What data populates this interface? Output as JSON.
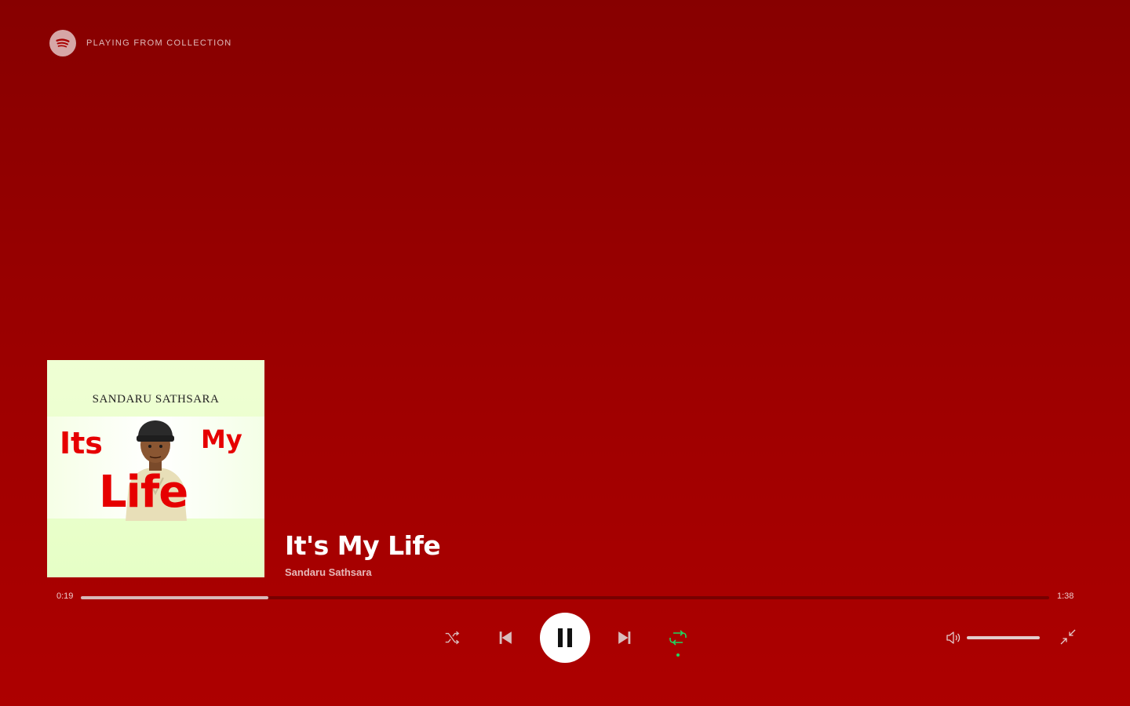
{
  "header": {
    "context_label": "PLAYING FROM COLLECTION",
    "logo_icon": "spotify-logo-icon"
  },
  "cover_art": {
    "artist_text": "SANDARU SATHSARA",
    "word_1": "Its",
    "word_2": "My",
    "word_3": "Life"
  },
  "track": {
    "title": "It's My Life",
    "artist": "Sandaru Sathsara"
  },
  "playback": {
    "elapsed": "0:19",
    "duration": "1:38",
    "progress_fraction": 0.194,
    "state": "playing"
  },
  "controls": {
    "shuffle_icon": "shuffle-icon",
    "previous_icon": "skip-back-icon",
    "play_pause_icon": "pause-icon",
    "next_icon": "skip-forward-icon",
    "repeat_icon": "repeat-icon",
    "repeat_active": true,
    "volume_icon": "volume-icon",
    "volume_fraction": 1.0,
    "exit_fullscreen_icon": "minimize-icon"
  },
  "colors": {
    "background_top": "#870000",
    "background_bottom": "#ad0000",
    "accent_green": "#1ed760"
  }
}
